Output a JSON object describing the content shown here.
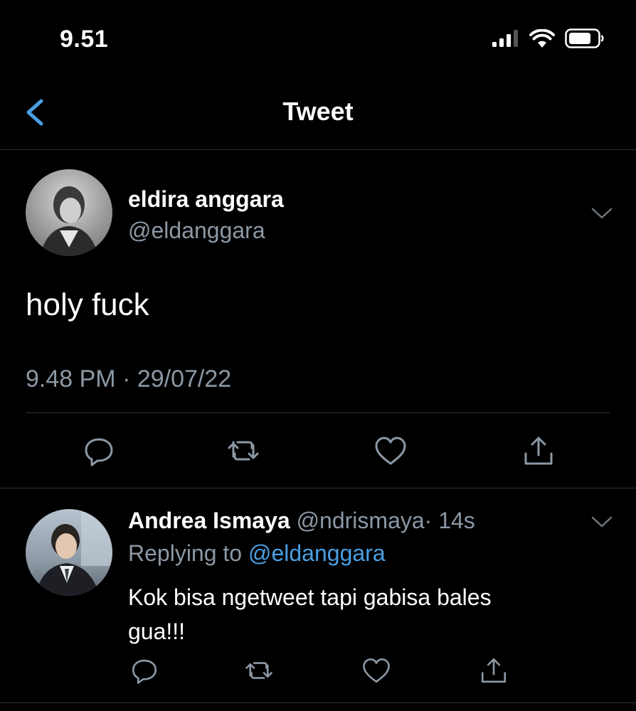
{
  "status_bar": {
    "time": "9.51"
  },
  "nav": {
    "title": "Tweet"
  },
  "tweet": {
    "author_name": "eldira anggara",
    "author_handle": "@eldanggara",
    "text": "holy fuck",
    "timestamp": "9.48 PM · 29/07/22"
  },
  "reply": {
    "author_name": "Andrea Ismaya",
    "author_handle": "@ndrismaya",
    "time_ago": "· 14s",
    "replying_to_prefix": "Replying to",
    "replying_to_handle": "@eldanggara",
    "text_line1": "Kok bisa ngetweet tapi gabisa bales",
    "text_line2": "gua!!!"
  },
  "colors": {
    "background": "#000000",
    "text": "#ffffff",
    "muted": "#8b98a5",
    "link": "#4a9fe3",
    "divider": "#2f3336"
  }
}
